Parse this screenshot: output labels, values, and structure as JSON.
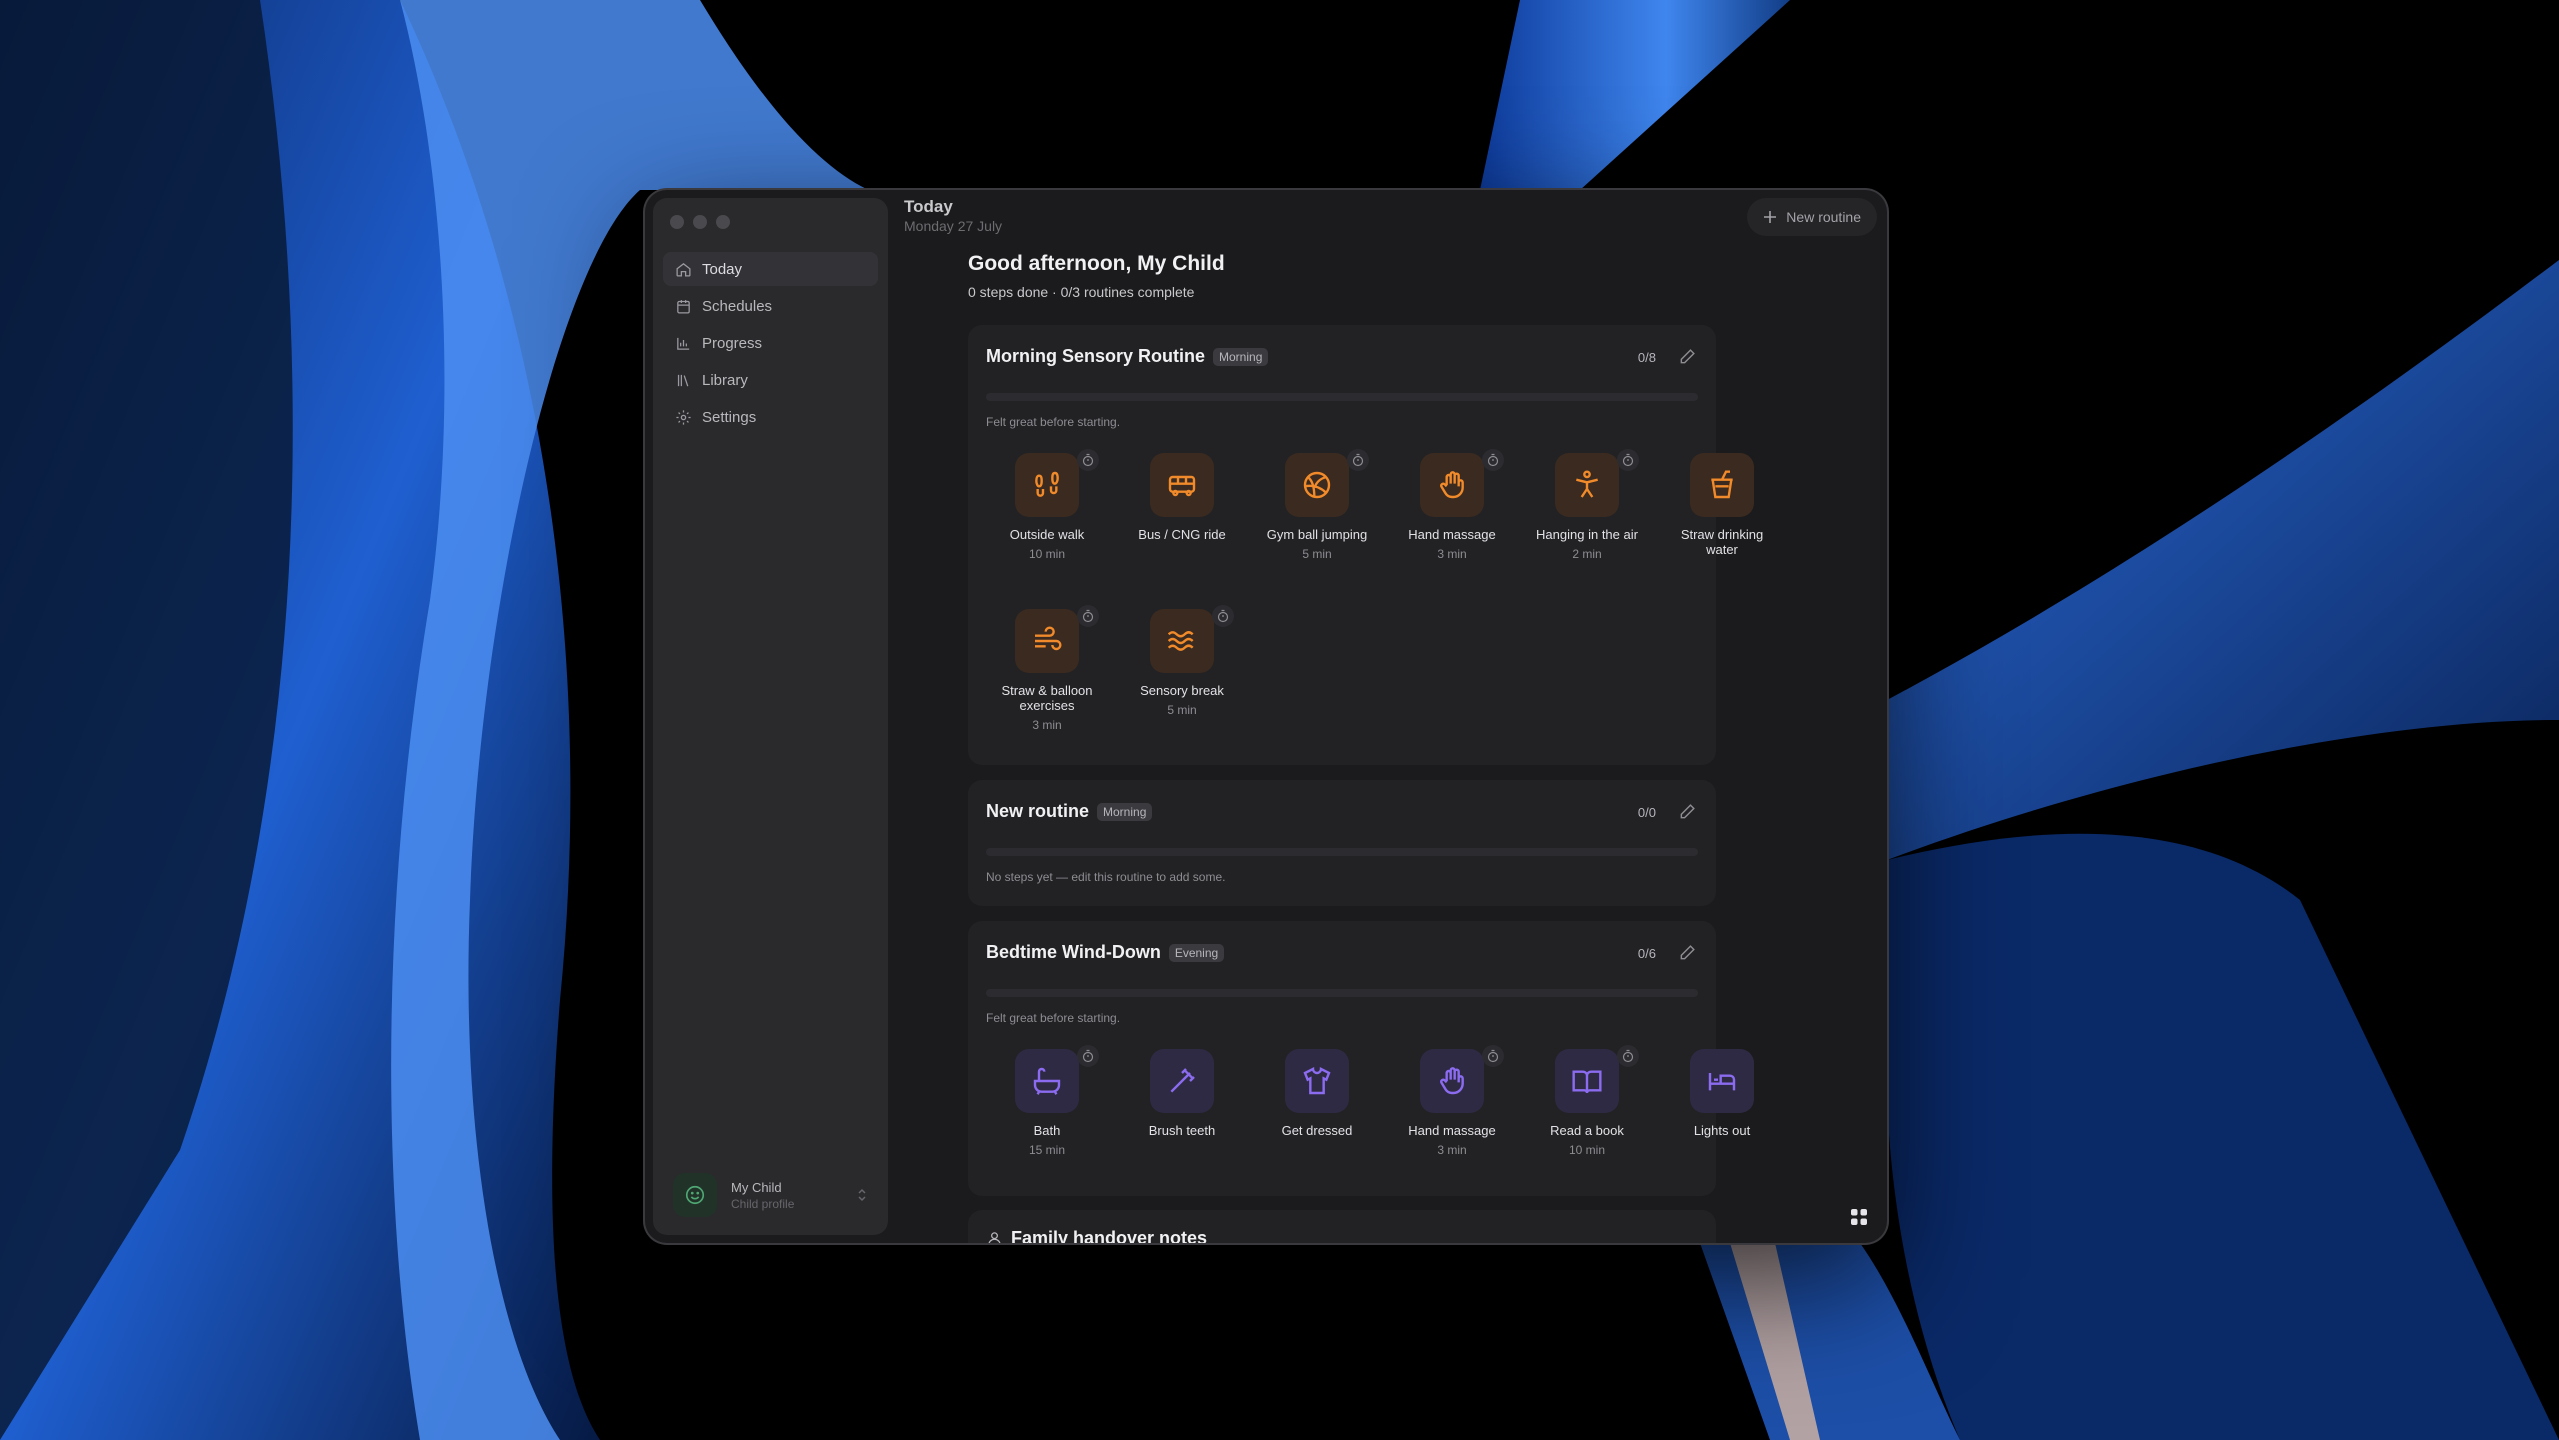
{
  "header": {
    "title": "Today",
    "date": "Monday 27 July",
    "new_routine_label": "New routine"
  },
  "sidebar": {
    "items": [
      {
        "label": "Today",
        "icon": "home-icon",
        "active": true
      },
      {
        "label": "Schedules",
        "icon": "calendar-icon"
      },
      {
        "label": "Progress",
        "icon": "chart-icon"
      },
      {
        "label": "Library",
        "icon": "library-icon"
      },
      {
        "label": "Settings",
        "icon": "gear-icon"
      }
    ],
    "profile": {
      "name": "My Child",
      "subtitle": "Child profile"
    }
  },
  "greeting": {
    "title": "Good afternoon, My Child",
    "summary": "0 steps done · 0/3 routines complete"
  },
  "routines": [
    {
      "title": "Morning Sensory Routine",
      "tag": "Morning",
      "count": "0/8",
      "progress": 0,
      "note": "Felt great before starting.",
      "color": "#f08a2a",
      "steps": [
        {
          "label": "Outside walk",
          "duration": "10 min",
          "icon": "footprints-icon",
          "timer": true
        },
        {
          "label": "Bus / CNG ride",
          "duration": "",
          "icon": "bus-icon",
          "timer": false
        },
        {
          "label": "Gym ball jumping",
          "duration": "5 min",
          "icon": "ball-icon",
          "timer": true
        },
        {
          "label": "Hand massage",
          "duration": "3 min",
          "icon": "hand-icon",
          "timer": true
        },
        {
          "label": "Hanging in the air",
          "duration": "2 min",
          "icon": "person-icon",
          "timer": true
        },
        {
          "label": "Straw drinking water",
          "duration": "",
          "icon": "cup-icon",
          "timer": false
        },
        {
          "label": "Straw & balloon exercises",
          "duration": "3 min",
          "icon": "wind-icon",
          "timer": true
        },
        {
          "label": "Sensory break",
          "duration": "5 min",
          "icon": "waves-icon",
          "timer": true
        }
      ]
    },
    {
      "title": "New routine",
      "tag": "Morning",
      "count": "0/0",
      "progress": 0,
      "note": "No steps yet — edit this routine to add some.",
      "steps": []
    },
    {
      "title": "Bedtime Wind-Down",
      "tag": "Evening",
      "count": "0/6",
      "progress": 0,
      "note": "Felt great before starting.",
      "color": "#8b6cf0",
      "steps": [
        {
          "label": "Bath",
          "duration": "15 min",
          "icon": "bath-icon",
          "timer": true
        },
        {
          "label": "Brush teeth",
          "duration": "",
          "icon": "toothbrush-icon",
          "timer": false
        },
        {
          "label": "Get dressed",
          "duration": "",
          "icon": "shirt-icon",
          "timer": false
        },
        {
          "label": "Hand massage",
          "duration": "3 min",
          "icon": "hand-icon",
          "timer": true
        },
        {
          "label": "Read a book",
          "duration": "10 min",
          "icon": "book-icon",
          "timer": true
        },
        {
          "label": "Lights out",
          "duration": "",
          "icon": "bed-icon",
          "timer": false
        }
      ]
    }
  ],
  "family_notes": {
    "title": "Family handover notes"
  }
}
